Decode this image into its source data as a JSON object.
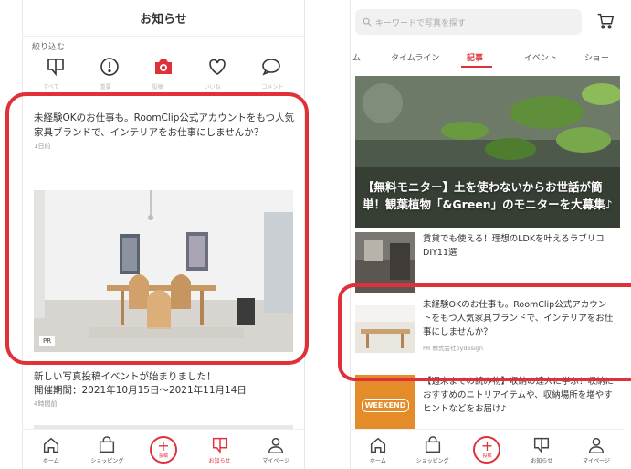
{
  "left": {
    "header_title": "お知らせ",
    "filter_label": "絞り込む",
    "categories": [
      {
        "icon": "comment-icon",
        "label": "すべて"
      },
      {
        "icon": "alert-icon",
        "label": "重要"
      },
      {
        "icon": "camera-icon",
        "label": "投稿"
      },
      {
        "icon": "heart-icon",
        "label": "いいね"
      },
      {
        "icon": "chat-icon",
        "label": "コメント"
      }
    ],
    "card1": {
      "text": "未経験OKのお仕事も。RoomClip公式アカウントをもつ人気家具ブランドで、インテリアをお仕事にしませんか？",
      "time": "1日前",
      "tag": "PR"
    },
    "card2": {
      "title": "新しい写真投稿イベントが始まりました！",
      "period": "開催期間：2021年10月15日〜2021年11月14日",
      "time": "4時間前"
    },
    "nav": [
      {
        "icon": "home-icon",
        "label": "ホーム"
      },
      {
        "icon": "shopping-bag-icon",
        "label": "ショッピング"
      },
      {
        "icon": "post-icon",
        "label": "投稿"
      },
      {
        "icon": "notification-icon",
        "label": "お知らせ"
      },
      {
        "icon": "user-icon",
        "label": "マイページ"
      }
    ]
  },
  "right": {
    "search_placeholder": "キーワードで写真を探す",
    "tabs": [
      "ム",
      "タイムライン",
      "記事",
      "イベント",
      "ショー"
    ],
    "active_tab": "記事",
    "hero_title": "【無料モニター】土を使わないからお世話が簡単！観葉植物「&Green」のモニターを大募集♪",
    "articles": [
      {
        "title": "賃貸でも使える！理想のLDKを叶えるラブリコDIY11選",
        "source": ""
      },
      {
        "title": "未経験OKのお仕事も。RoomClip公式アカウントをもつ人気家具ブランドで、インテリアをお仕事にしませんか？",
        "source": "PR 株式会社bydesign"
      },
      {
        "title": "【週末までの読み物】収納の達人に学ぶ！収納におすすめのニトリアイテムや、収納場所を増やすヒントなどをお届け♪",
        "source": "",
        "thumb_text": "WEEKEND"
      }
    ],
    "nav": [
      {
        "icon": "home-icon",
        "label": "ホーム"
      },
      {
        "icon": "shopping-bag-icon",
        "label": "ショッピング"
      },
      {
        "icon": "post-icon",
        "label": "投稿"
      },
      {
        "icon": "notification-icon",
        "label": "お知らせ"
      },
      {
        "icon": "user-icon",
        "label": "マイページ"
      }
    ]
  },
  "colors": {
    "accent": "#e0303a",
    "highlight_frame": "#e0303a"
  }
}
